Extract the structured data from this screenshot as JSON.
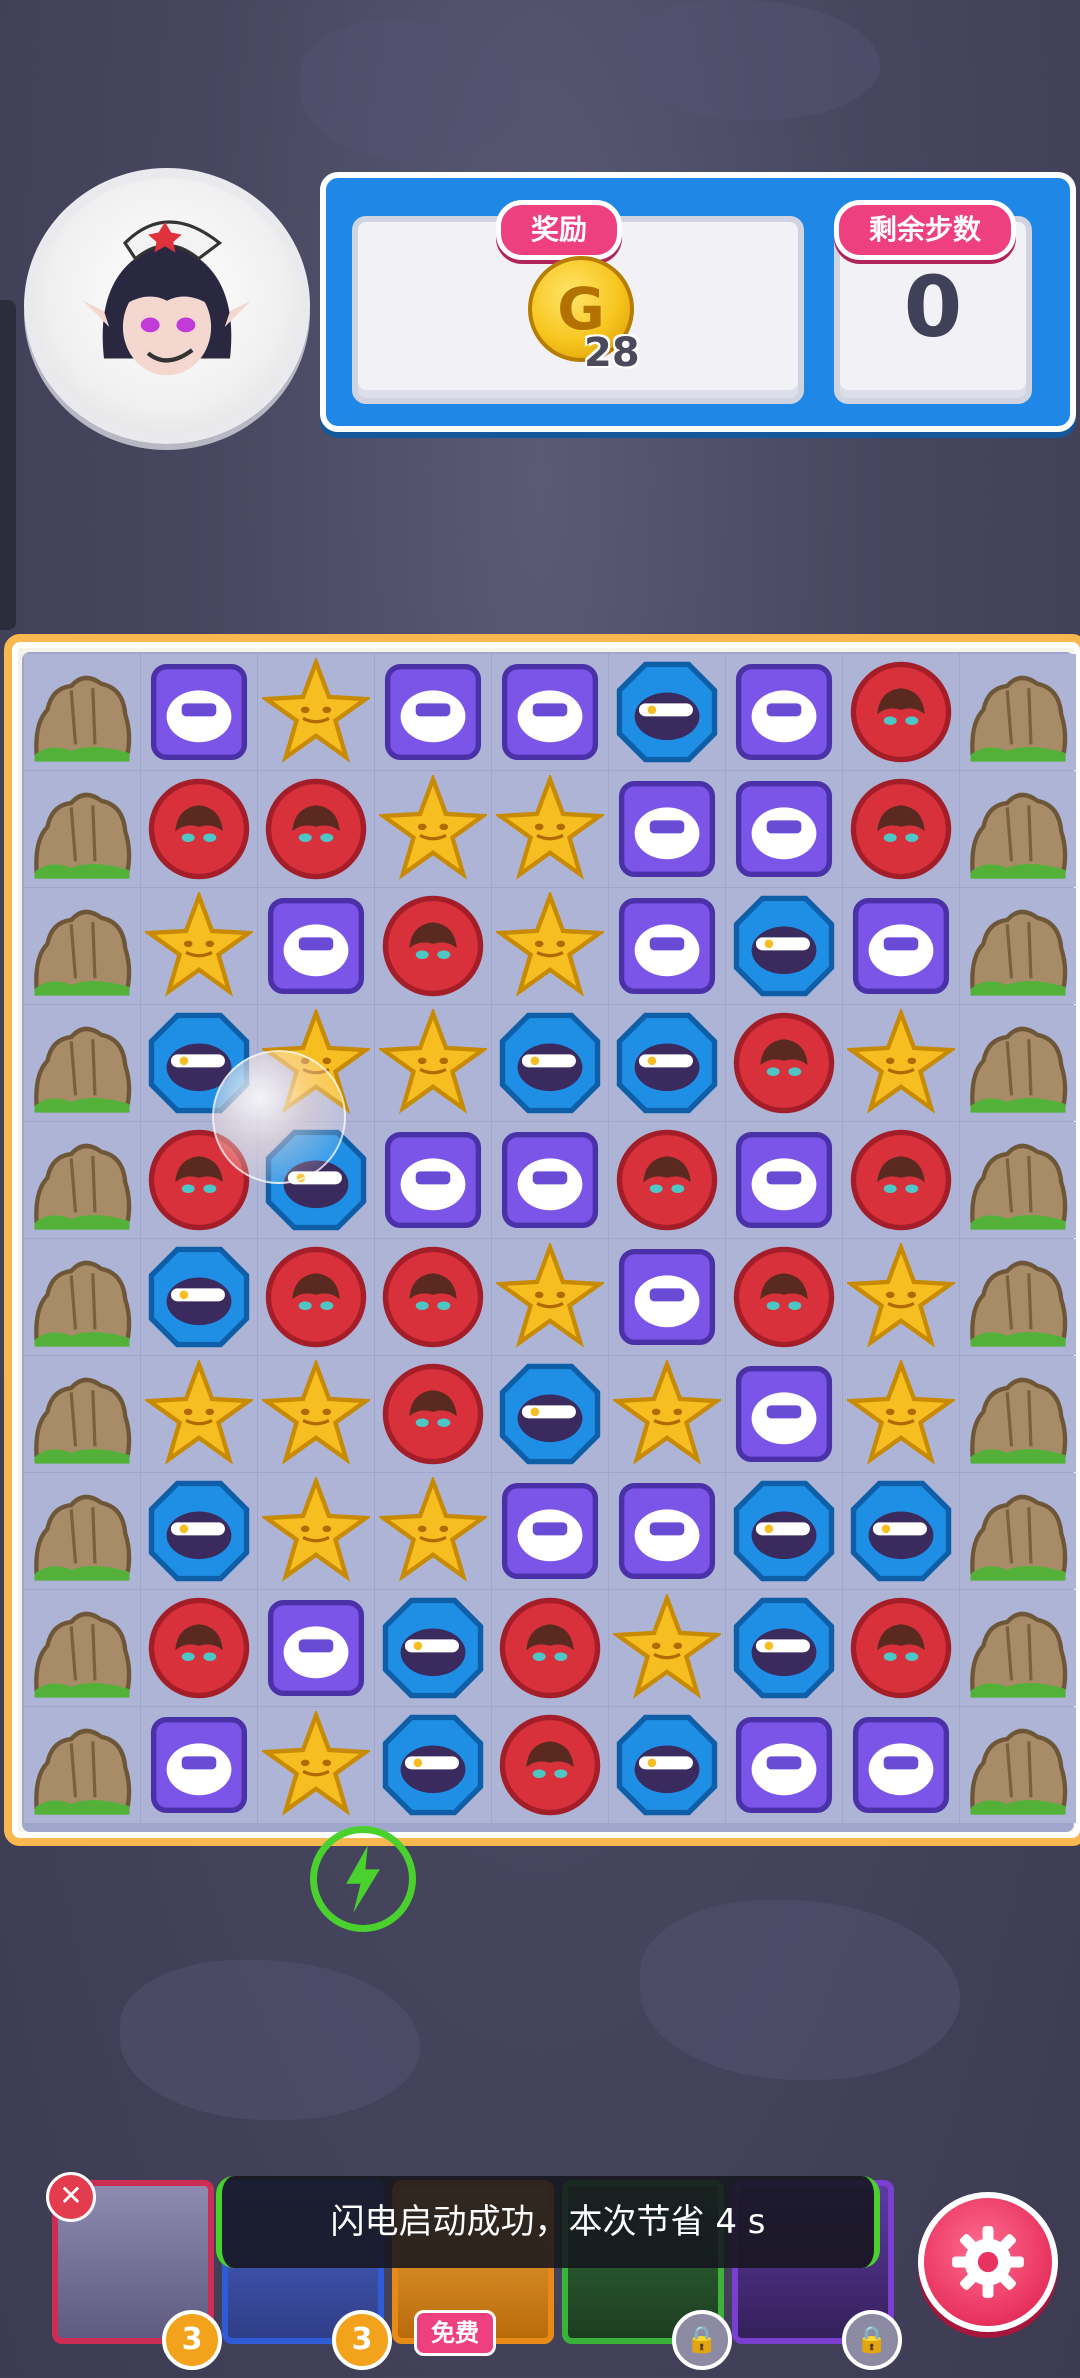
{
  "panel": {
    "reward_label": "奖励",
    "steps_label": "剩余步数",
    "coin_symbol": "G",
    "coin_count": "28",
    "steps_value": "0"
  },
  "board": {
    "rows": [
      [
        "rock",
        "purple",
        "star",
        "purple",
        "purple",
        "blue",
        "purple",
        "red",
        "rock"
      ],
      [
        "rock",
        "red",
        "red",
        "star",
        "star",
        "purple",
        "purple",
        "red",
        "rock"
      ],
      [
        "rock",
        "star",
        "purple",
        "red",
        "star",
        "purple",
        "blue",
        "purple",
        "rock"
      ],
      [
        "rock",
        "blue",
        "star",
        "star",
        "blue",
        "blue",
        "red",
        "star",
        "rock"
      ],
      [
        "rock",
        "red",
        "blue",
        "purple",
        "purple",
        "red",
        "purple",
        "red",
        "rock"
      ],
      [
        "rock",
        "blue",
        "red",
        "red",
        "star",
        "purple",
        "red",
        "star",
        "rock"
      ],
      [
        "rock",
        "star",
        "star",
        "red",
        "blue",
        "star",
        "purple",
        "star",
        "rock"
      ],
      [
        "rock",
        "blue",
        "star",
        "star",
        "purple",
        "purple",
        "blue",
        "blue",
        "rock"
      ],
      [
        "rock",
        "red",
        "purple",
        "blue",
        "red",
        "star",
        "blue",
        "red",
        "rock"
      ],
      [
        "rock",
        "purple",
        "star",
        "blue",
        "red",
        "blue",
        "purple",
        "purple",
        "rock"
      ]
    ],
    "colors": {
      "red": "#d8313b",
      "purple": "#7b55e8",
      "blue": "#1f8fe6",
      "star": "#f7be22",
      "rock": "#a88c68",
      "frame": "#f8b84f"
    }
  },
  "bottom": {
    "cards": [
      {
        "icon": "hero-card-icon",
        "badge": "3",
        "color": "pink"
      },
      {
        "icon": "hero-card-icon",
        "badge": "3",
        "color": "blue"
      },
      {
        "icon": "hero-card-icon",
        "free_label": "免费",
        "color": "orange"
      },
      {
        "icon": "hero-card-icon",
        "locked": true,
        "color": "green"
      },
      {
        "icon": "hero-card-icon",
        "locked": true,
        "color": "purple"
      }
    ],
    "toast": "闪电启动成功，本次节省 4 s"
  }
}
